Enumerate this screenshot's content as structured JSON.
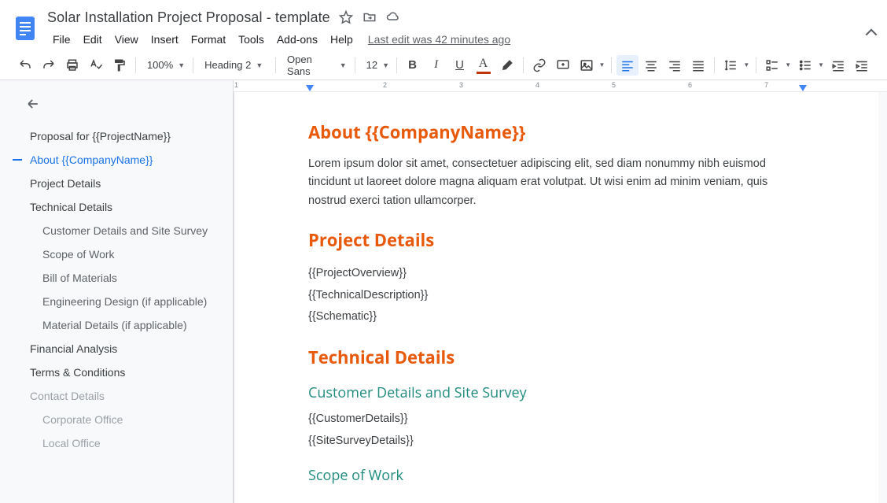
{
  "header": {
    "title": "Solar Installation Project Proposal - template",
    "last_edit": "Last edit was 42 minutes ago",
    "menus": [
      "File",
      "Edit",
      "View",
      "Insert",
      "Format",
      "Tools",
      "Add-ons",
      "Help"
    ]
  },
  "toolbar": {
    "zoom": "100%",
    "style": "Heading 2",
    "font": "Open Sans",
    "size": "12"
  },
  "outline": {
    "items": [
      {
        "label": "Proposal for {{ProjectName}}",
        "level": 1
      },
      {
        "label": "About {{CompanyName}}",
        "level": 1,
        "active": true
      },
      {
        "label": "Project Details",
        "level": 1
      },
      {
        "label": "Technical Details",
        "level": 1
      },
      {
        "label": "Customer Details and Site Survey",
        "level": 2
      },
      {
        "label": "Scope of Work",
        "level": 2
      },
      {
        "label": "Bill of Materials",
        "level": 2
      },
      {
        "label": "Engineering Design (if applicable)",
        "level": 2,
        "ellipsis": true
      },
      {
        "label": "Material Details (if applicable)",
        "level": 2
      },
      {
        "label": "Financial Analysis",
        "level": 1
      },
      {
        "label": "Terms & Conditions",
        "level": 1
      },
      {
        "label": "Contact Details",
        "level": 1,
        "dim": true
      },
      {
        "label": "Corporate Office",
        "level": 2,
        "dim": true
      },
      {
        "label": "Local Office",
        "level": 2,
        "dim": true
      }
    ]
  },
  "document": {
    "h_about": "About {{CompanyName}}",
    "about_para": "Lorem ipsum dolor sit amet, consectetuer adipiscing elit, sed diam nonummy nibh euismod tincidunt ut laoreet dolore magna aliquam erat volutpat. Ut wisi enim ad minim veniam, quis nostrud exerci tation ullamcorper.",
    "h_project": "Project Details",
    "p_overview": "{{ProjectOverview}}",
    "p_techdesc": "{{TechnicalDescription}}",
    "p_schematic": "{{Schematic}}",
    "h_tech": "Technical Details",
    "h_customer": "Customer Details and Site Survey",
    "p_custdetails": "{{CustomerDetails}}",
    "p_sitesurvey": "{{SiteSurveyDetails}}",
    "h_scope": "Scope of Work"
  },
  "ruler": {
    "marks": [
      1,
      2,
      3,
      4,
      5,
      6,
      7
    ]
  }
}
